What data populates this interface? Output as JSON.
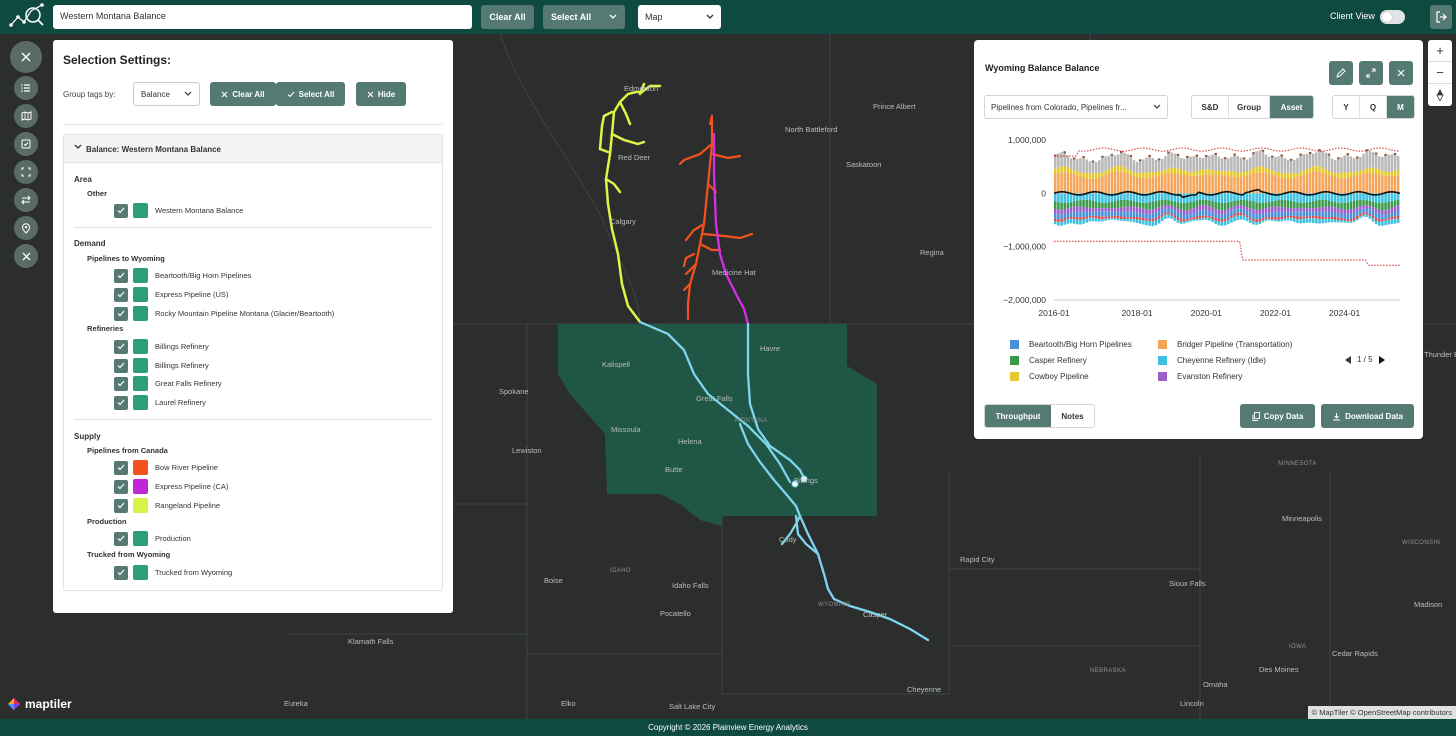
{
  "topbar": {
    "search_value": "Western Montana Balance",
    "clear_all": "Clear All",
    "select_all": "Select All",
    "view_select": "Map",
    "client_view": "Client View"
  },
  "selection": {
    "title": "Selection Settings:",
    "group_label": "Group tags by:",
    "group_value": "Balance",
    "clear_all": "Clear All",
    "select_all": "Select All",
    "hide": "Hide",
    "accordion_title": "Balance: Western Montana Balance",
    "sections": {
      "area": "Area",
      "area_other": "Other",
      "area_item": "Western Montana Balance",
      "demand": "Demand",
      "pipes_to_wy": "Pipelines to Wyoming",
      "d1": "Beartooth/Big Horn Pipelines",
      "d2": "Express Pipeline (US)",
      "d3": "Rocky Mountain Pipeline Montana (Glacier/Beartooth)",
      "refineries": "Refineries",
      "r1": "Billings Refinery",
      "r2": "Billings Refinery",
      "r3": "Great Falls Refinery",
      "r4": "Laurel Refinery",
      "supply": "Supply",
      "pipes_from_ca": "Pipelines from Canada",
      "s1": "Bow River Pipeline",
      "s2": "Express Pipeline (CA)",
      "s3": "Rangeland Pipeline",
      "production": "Production",
      "p1": "Production",
      "trucked": "Trucked from Wyoming",
      "t1": "Trucked from Wyoming"
    },
    "colors": {
      "green": "#2e9e74",
      "bow_river": "#f4511e",
      "express_ca": "#c026d3",
      "rangeland": "#d9f24a"
    }
  },
  "chart_panel": {
    "title": "Wyoming Balance Balance",
    "asset_select": "Pipelines from Colorado, Pipelines fr...",
    "mode_tabs": [
      "S&D",
      "Group",
      "Asset"
    ],
    "period_tabs": [
      "Y",
      "Q",
      "M"
    ],
    "pager": "1 / 5",
    "footer_tabs": [
      "Throughput",
      "Notes"
    ],
    "copy_data": "Copy Data",
    "download_data": "Download Data"
  },
  "chart_data": {
    "type": "area",
    "title": "Wyoming Balance Balance",
    "y_ticks": [
      "1,000,000",
      "0",
      "−1,000,000",
      "−2,000,000"
    ],
    "x_ticks": [
      "2016-01",
      "2018-01",
      "2020-01",
      "2022-01",
      "2024-01"
    ],
    "ylim": [
      -2000000,
      1000000
    ],
    "legend": [
      {
        "name": "Beartooth/Big Horn Pipelines",
        "color": "#4a90d9"
      },
      {
        "name": "Bridger Pipeline (Transportation)",
        "color": "#f5a55a"
      },
      {
        "name": "Casper Refinery",
        "color": "#3a9a4a"
      },
      {
        "name": "Cheyenne Refinery (Idle)",
        "color": "#3ec1e0"
      },
      {
        "name": "Cowboy Pipeline",
        "color": "#e6c92e"
      },
      {
        "name": "Evanston Refinery",
        "color": "#9b5fc9"
      }
    ],
    "series_approx": {
      "positive_top": 780000,
      "negative_bottom": -850000,
      "upper_bound_dotted": 830000,
      "lower_bound_dotted_start": -900000,
      "lower_bound_dotted_end": -1350000,
      "net_line": 0
    }
  },
  "map": {
    "labels": [
      {
        "t": "Edmonton"
      },
      {
        "t": "Prince Albert"
      },
      {
        "t": "North Battleford"
      },
      {
        "t": "Red Deer"
      },
      {
        "t": "Saskatoon"
      },
      {
        "t": "Calgary"
      },
      {
        "t": "Regina"
      },
      {
        "t": "Medicine Hat"
      },
      {
        "t": "Havre"
      },
      {
        "t": "Kalispell"
      },
      {
        "t": "Spokane"
      },
      {
        "t": "Great Falls"
      },
      {
        "t": "Missoula"
      },
      {
        "t": "Helena"
      },
      {
        "t": "Lewiston"
      },
      {
        "t": "Butte"
      },
      {
        "t": "Billings"
      },
      {
        "t": "Cody"
      },
      {
        "t": "Rapid City"
      },
      {
        "t": "Minneapolis"
      },
      {
        "t": "Boise"
      },
      {
        "t": "IDAHO"
      },
      {
        "t": "Idaho Falls"
      },
      {
        "t": "Pocatello"
      },
      {
        "t": "WYOMING"
      },
      {
        "t": "Casper"
      },
      {
        "t": "Sioux Falls"
      },
      {
        "t": "Madison"
      },
      {
        "t": "MINNESOTA"
      },
      {
        "t": "WISCONSIN"
      },
      {
        "t": "Klamath Falls"
      },
      {
        "t": "Des Moines"
      },
      {
        "t": "IOWA"
      },
      {
        "t": "Cedar Rapids"
      },
      {
        "t": "NEBRASKA"
      },
      {
        "t": "Omaha"
      },
      {
        "t": "Cheyenne"
      },
      {
        "t": "Eureka"
      },
      {
        "t": "Elko"
      },
      {
        "t": "Salt Lake City"
      },
      {
        "t": "Lincoln"
      },
      {
        "t": "MONTANA"
      },
      {
        "t": "Thunder Bay"
      }
    ],
    "brand": "maptiler",
    "attribution": "© MapTiler © OpenStreetMap contributors"
  },
  "footer": {
    "copyright": "Copyright © 2026 Plainview Energy Analytics"
  }
}
